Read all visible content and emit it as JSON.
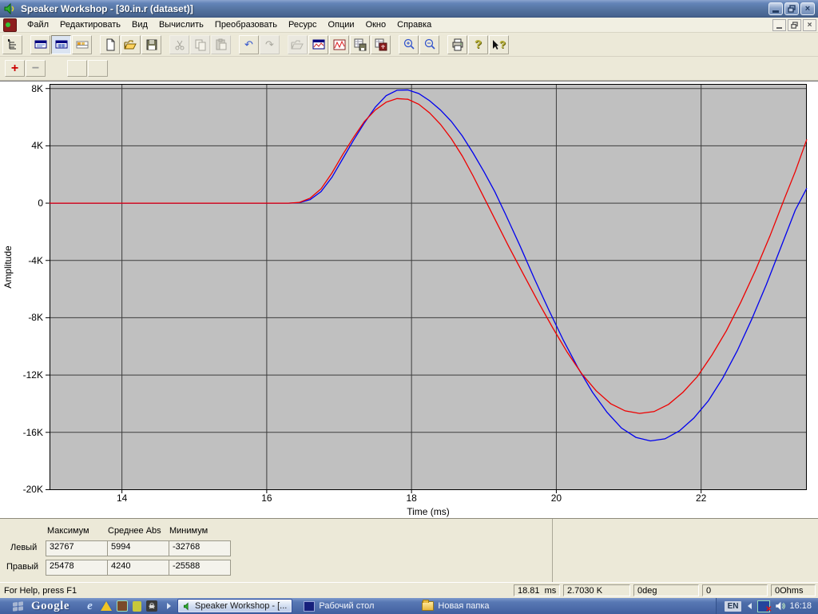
{
  "window": {
    "title": "Speaker Workshop - [30.in.r (dataset)]"
  },
  "menu": {
    "items": [
      {
        "label": "Файл"
      },
      {
        "label": "Редактировать"
      },
      {
        "label": "Вид"
      },
      {
        "label": "Вычислить"
      },
      {
        "label": "Преобразовать"
      },
      {
        "label": "Ресурс"
      },
      {
        "label": "Опции"
      },
      {
        "label": "Окно"
      },
      {
        "label": "Справка"
      }
    ]
  },
  "icons": {
    "close_glyph": "×",
    "restore_hint": "restore",
    "help_glyph": "?",
    "context_help_glyph": "?",
    "add_glyph": "+",
    "remove_glyph": "−",
    "undo_glyph": "↶",
    "redo_glyph": "↷",
    "skull_glyph": "☠"
  },
  "chart_data": {
    "type": "line",
    "title": "",
    "xlabel": "Time (ms)",
    "ylabel": "Amplitude",
    "xlim": [
      13,
      23.46
    ],
    "ylim": [
      -20030,
      8320
    ],
    "grid": true,
    "legend": false,
    "plot_bg": "#c0c0c0",
    "grid_color": "#3d3d3d",
    "x_ticks": [
      {
        "v": 14,
        "label": "14"
      },
      {
        "v": 16,
        "label": "16"
      },
      {
        "v": 18,
        "label": "18"
      },
      {
        "v": 20,
        "label": "20"
      },
      {
        "v": 22,
        "label": "22"
      }
    ],
    "y_ticks": [
      {
        "v": 8000,
        "label": "8K"
      },
      {
        "v": 4000,
        "label": "4K"
      },
      {
        "v": 0,
        "label": "0"
      },
      {
        "v": -4000,
        "label": "-4K"
      },
      {
        "v": -8000,
        "label": "-8K"
      },
      {
        "v": -12000,
        "label": "-12K"
      },
      {
        "v": -16000,
        "label": "-16K"
      },
      {
        "v": -20000,
        "label": "-20K"
      }
    ],
    "series": [
      {
        "name": "Левый",
        "color": "#0000ee",
        "points": [
          [
            13,
            0
          ],
          [
            13.5,
            0
          ],
          [
            14,
            0
          ],
          [
            14.5,
            0
          ],
          [
            15,
            0
          ],
          [
            15.5,
            0
          ],
          [
            16,
            0
          ],
          [
            16.3,
            0
          ],
          [
            16.45,
            30
          ],
          [
            16.6,
            250
          ],
          [
            16.75,
            800
          ],
          [
            16.9,
            1800
          ],
          [
            17.05,
            3100
          ],
          [
            17.2,
            4400
          ],
          [
            17.35,
            5600
          ],
          [
            17.5,
            6700
          ],
          [
            17.65,
            7500
          ],
          [
            17.8,
            7880
          ],
          [
            17.95,
            7900
          ],
          [
            18.1,
            7650
          ],
          [
            18.25,
            7150
          ],
          [
            18.4,
            6500
          ],
          [
            18.55,
            5700
          ],
          [
            18.7,
            4700
          ],
          [
            18.85,
            3500
          ],
          [
            19.0,
            2200
          ],
          [
            19.15,
            800
          ],
          [
            19.3,
            -800
          ],
          [
            19.5,
            -3000
          ],
          [
            19.7,
            -5300
          ],
          [
            19.9,
            -7500
          ],
          [
            20.1,
            -9600
          ],
          [
            20.3,
            -11500
          ],
          [
            20.5,
            -13200
          ],
          [
            20.7,
            -14600
          ],
          [
            20.9,
            -15700
          ],
          [
            21.1,
            -16350
          ],
          [
            21.3,
            -16600
          ],
          [
            21.5,
            -16450
          ],
          [
            21.7,
            -15900
          ],
          [
            21.9,
            -15000
          ],
          [
            22.1,
            -13800
          ],
          [
            22.3,
            -12200
          ],
          [
            22.5,
            -10300
          ],
          [
            22.7,
            -8100
          ],
          [
            22.9,
            -5700
          ],
          [
            23.1,
            -3100
          ],
          [
            23.3,
            -500
          ],
          [
            23.46,
            1050
          ]
        ]
      },
      {
        "name": "Правый",
        "color": "#ee0000",
        "points": [
          [
            13,
            0
          ],
          [
            13.5,
            0
          ],
          [
            14,
            0
          ],
          [
            14.5,
            0
          ],
          [
            15,
            0
          ],
          [
            15.5,
            0
          ],
          [
            16,
            0
          ],
          [
            16.3,
            0
          ],
          [
            16.45,
            50
          ],
          [
            16.6,
            350
          ],
          [
            16.75,
            1000
          ],
          [
            16.9,
            2100
          ],
          [
            17.05,
            3400
          ],
          [
            17.2,
            4600
          ],
          [
            17.35,
            5700
          ],
          [
            17.5,
            6500
          ],
          [
            17.65,
            7050
          ],
          [
            17.8,
            7300
          ],
          [
            17.95,
            7250
          ],
          [
            18.1,
            6900
          ],
          [
            18.25,
            6300
          ],
          [
            18.4,
            5500
          ],
          [
            18.55,
            4500
          ],
          [
            18.7,
            3300
          ],
          [
            18.85,
            1900
          ],
          [
            19.0,
            400
          ],
          [
            19.15,
            -1100
          ],
          [
            19.35,
            -3100
          ],
          [
            19.55,
            -5000
          ],
          [
            19.75,
            -6900
          ],
          [
            19.95,
            -8700
          ],
          [
            20.15,
            -10400
          ],
          [
            20.35,
            -11900
          ],
          [
            20.55,
            -13100
          ],
          [
            20.75,
            -14000
          ],
          [
            20.95,
            -14500
          ],
          [
            21.15,
            -14680
          ],
          [
            21.35,
            -14550
          ],
          [
            21.55,
            -14050
          ],
          [
            21.75,
            -13200
          ],
          [
            21.95,
            -12100
          ],
          [
            22.15,
            -10600
          ],
          [
            22.35,
            -8900
          ],
          [
            22.55,
            -6900
          ],
          [
            22.75,
            -4700
          ],
          [
            22.95,
            -2300
          ],
          [
            23.15,
            300
          ],
          [
            23.3,
            2200
          ],
          [
            23.46,
            4450
          ]
        ]
      }
    ]
  },
  "stats": {
    "headers": [
      "Максимум",
      "Среднее Abs",
      "Минимум"
    ],
    "rows": [
      {
        "label": "Левый",
        "max": "32767",
        "avg": "5994",
        "min": "-32768"
      },
      {
        "label": "Правый",
        "max": "25478",
        "avg": "4240",
        "min": "-25588"
      }
    ]
  },
  "status": {
    "help": "For Help, press F1",
    "fields": [
      {
        "value": "18.81  ms"
      },
      {
        "value": "2.7030 K"
      },
      {
        "value": "0deg"
      },
      {
        "value": "0"
      },
      {
        "value": "0Ohms"
      }
    ]
  },
  "taskbar": {
    "search_label": "Google",
    "tasks": [
      {
        "label": "Speaker Workshop - [...",
        "active": true
      },
      {
        "label": "Рабочий стол"
      },
      {
        "label": "Новая папка"
      }
    ],
    "tray": {
      "language": "EN",
      "time": "16:18"
    }
  }
}
